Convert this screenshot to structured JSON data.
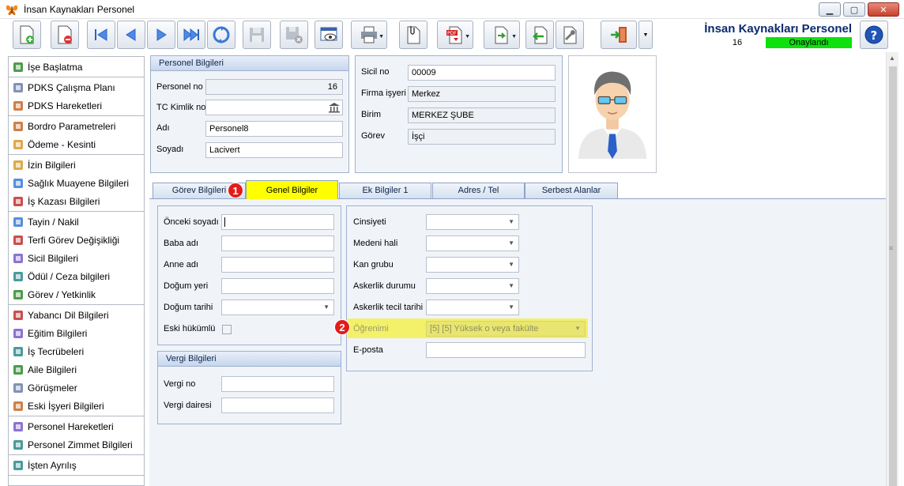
{
  "window": {
    "title": "İnsan Kaynakları Personel"
  },
  "header": {
    "title": "İnsan Kaynakları Personel",
    "record_no": "16",
    "status": "Onaylandı"
  },
  "sidebar": {
    "groups": [
      [
        "İşe Başlatma"
      ],
      [
        "PDKS Çalışma Planı",
        "PDKS Hareketleri"
      ],
      [
        "Bordro Parametreleri",
        "Ödeme - Kesinti"
      ],
      [
        "İzin Bilgileri",
        "Sağlık Muayene Bilgileri",
        "İş Kazası Bilgileri"
      ],
      [
        "Tayin / Nakil",
        "Terfi Görev Değişikliği",
        "Sicil Bilgileri",
        "Ödül / Ceza bilgileri",
        "Görev / Yetkinlik"
      ],
      [
        "Yabancı Dil Bilgileri",
        "Eğitim Bilgileri",
        "İş Tecrübeleri",
        "Aile Bilgileri",
        "Görüşmeler",
        "Eski İşyeri Bilgileri"
      ],
      [
        "Personel Hareketleri",
        "Personel Zimmet Bilgileri"
      ],
      [
        "İşten Ayrılış"
      ]
    ]
  },
  "personel": {
    "header": "Personel Bilgileri",
    "no_label": "Personel no",
    "no_value": "16",
    "tc_label": "TC Kimlik no",
    "tc_value": "",
    "adi_label": "Adı",
    "adi_value": "Personel8",
    "soyadi_label": "Soyadı",
    "soyadi_value": "Lacivert"
  },
  "firma": {
    "sicil_label": "Sicil no",
    "sicil_value": "00009",
    "firma_label": "Firma işyeri",
    "firma_value": "Merkez",
    "birim_label": "Birim",
    "birim_value": "MERKEZ ŞUBE",
    "gorev_label": "Görev",
    "gorev_value": "İşçi"
  },
  "tabs": [
    "Görev Bilgileri",
    "Genel Bilgiler",
    "Ek Bilgiler 1",
    "Adres / Tel",
    "Serbest Alanlar"
  ],
  "badges": [
    "1",
    "2"
  ],
  "genel": {
    "onceki_soyadi": "Önceki soyadı",
    "baba_adi": "Baba adı",
    "anne_adi": "Anne adı",
    "dogum_yeri": "Doğum yeri",
    "dogum_tarihi": "Doğum tarihi",
    "eski_hukumlu": "Eski hükümlü"
  },
  "vergi": {
    "header": "Vergi Bilgileri",
    "vergi_no": "Vergi no",
    "vergi_dairesi": "Vergi dairesi"
  },
  "diger": {
    "cinsiyeti": "Cinsiyeti",
    "medeni_hali": "Medeni hali",
    "kan_grubu": "Kan grubu",
    "askerlik_durumu": "Askerlik durumu",
    "askerlik_tecil": "Askerlik tecil tarihi",
    "ogrenimi": "Öğrenimi",
    "ogrenimi_value": "[5] [5] Yüksek o veya fakülte",
    "eposta": "E-posta"
  },
  "colors": {
    "status_green": "#0ee00e",
    "active_tab": "#ffff00",
    "highlight": "#f3f06a",
    "badge_red": "#e31b1b",
    "title_blue": "#0b2a6e"
  }
}
